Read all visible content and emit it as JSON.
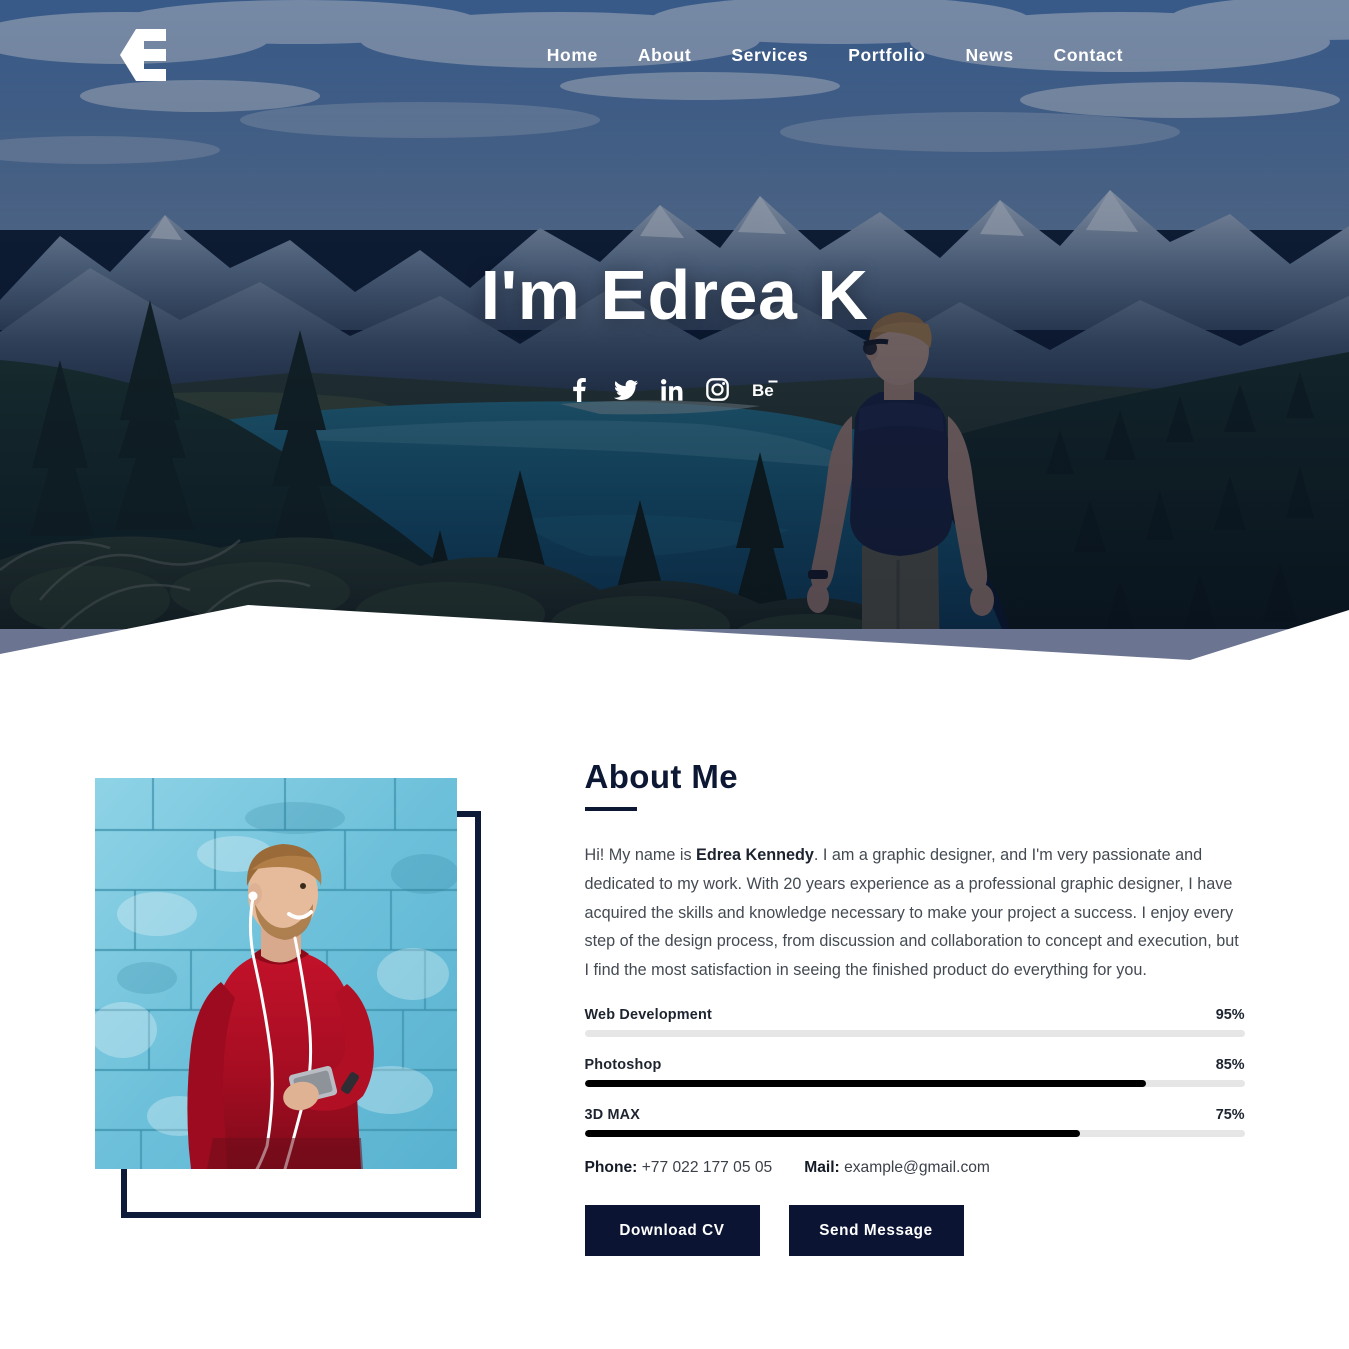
{
  "site": {
    "logo_icon": "stylized-e-arrow-logo"
  },
  "nav": {
    "items": [
      {
        "label": "Home",
        "name": "nav-home"
      },
      {
        "label": "About",
        "name": "nav-about"
      },
      {
        "label": "Services",
        "name": "nav-services"
      },
      {
        "label": "Portfolio",
        "name": "nav-portfolio"
      },
      {
        "label": "News",
        "name": "nav-news"
      },
      {
        "label": "Contact",
        "name": "nav-contact"
      }
    ]
  },
  "hero": {
    "title": "I'm Edrea K",
    "background_description": "mountain lake landscape with man standing facing away",
    "socials": [
      {
        "icon": "facebook-icon",
        "label": "Facebook"
      },
      {
        "icon": "twitter-icon",
        "label": "Twitter"
      },
      {
        "icon": "linkedin-icon",
        "label": "LinkedIn"
      },
      {
        "icon": "instagram-icon",
        "label": "Instagram"
      },
      {
        "icon": "behance-icon",
        "label": "Behance"
      }
    ],
    "divider_band_color": "#6b7490"
  },
  "about": {
    "heading": "About Me",
    "photo_description": "smiling man in red sweater with earphones holding phone against blue brick wall",
    "paragraph_lead": "Hi! My name is ",
    "paragraph_name": "Edrea Kennedy",
    "paragraph_rest": ". I am a graphic designer, and I'm very passionate and dedicated to my work. With 20 years experience as a professional graphic designer, I have acquired the skills and knowledge necessary to make your project a success. I enjoy every step of the design process, from discussion and collaboration to concept and execution, but I find the most satisfaction in seeing the finished product do everything for you.",
    "skills": [
      {
        "name": "Web Development",
        "percent_label": "95%",
        "value": 95,
        "filled": 0
      },
      {
        "name": "Photoshop",
        "percent_label": "85%",
        "value": 85,
        "filled": 85
      },
      {
        "name": "3D MAX",
        "percent_label": "75%",
        "value": 75,
        "filled": 75
      }
    ],
    "contact": {
      "phone_label": "Phone:",
      "phone_value": "+77 022 177 05 05",
      "mail_label": "Mail:",
      "mail_value": "example@gmail.com"
    },
    "buttons": {
      "download_cv": "Download CV",
      "send_message": "Send Message"
    }
  },
  "colors": {
    "navy": "#0b1433",
    "heading": "#0c1733",
    "bar_fill": "#000000",
    "bar_track": "#e6e6e6",
    "divider_gray": "#6b7490"
  }
}
